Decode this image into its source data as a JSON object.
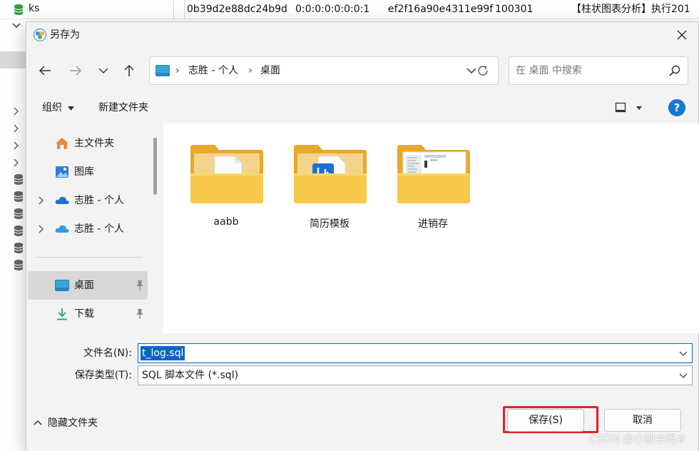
{
  "background": {
    "tree_db_name": "ks",
    "row_cells": [
      "0b39d2e88dc24b9d",
      "0:0:0:0:0:0:0:1",
      "ef2f16a90e4311e99f",
      "100301",
      "【柱状图表分析】执行201"
    ]
  },
  "dialog": {
    "title": "另存为",
    "address": {
      "crumbs": [
        "志胜 - 个人",
        "桌面"
      ]
    },
    "search": {
      "placeholder": "在 桌面 中搜索"
    },
    "command_bar": {
      "organize": "组织",
      "new_folder": "新建文件夹"
    },
    "nav_pane": {
      "items": [
        {
          "label": "主文件夹",
          "icon": "home-icon"
        },
        {
          "label": "图库",
          "icon": "gallery-icon"
        },
        {
          "label": "志胜 - 个人",
          "icon": "onedrive-icon"
        },
        {
          "label": "志胜 - 个人",
          "icon": "onedrive-icon"
        },
        {
          "label": "桌面",
          "icon": "desktop-icon",
          "selected": true
        },
        {
          "label": "下载",
          "icon": "download-icon"
        }
      ]
    },
    "files": [
      {
        "name": "aabb",
        "icon": "folder-doc-icon"
      },
      {
        "name": "简历模板",
        "icon": "folder-word-icon"
      },
      {
        "name": "进销存",
        "icon": "folder-preview-icon"
      }
    ],
    "form": {
      "filename_label": "文件名(N):",
      "filename_value": "t_log.sql",
      "filetype_label": "保存类型(T):",
      "filetype_value": "SQL 脚本文件 (*.sql)"
    },
    "footer": {
      "hide_folders": "隐藏文件夹",
      "save": "保存(S)",
      "cancel": "取消"
    }
  },
  "watermark": "CSDN @小郄会码#",
  "colors": {
    "accent": "#0067c0",
    "selection": "#0a64c8",
    "highlight_outline": "#e52020",
    "help": "#1976d2",
    "folder": "#f7c548"
  }
}
